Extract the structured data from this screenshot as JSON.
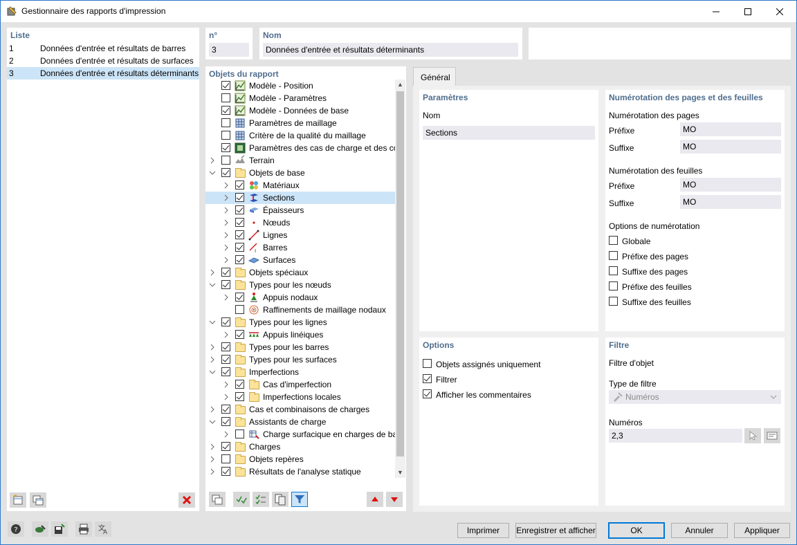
{
  "window": {
    "title": "Gestionnaire des rapports d'impression"
  },
  "liste": {
    "title": "Liste",
    "items": [
      {
        "num": "1",
        "label": "Données d'entrée et résultats de barres"
      },
      {
        "num": "2",
        "label": "Données d'entrée et résultats de surfaces"
      },
      {
        "num": "3",
        "label": "Données d'entrée et résultats déterminants"
      }
    ]
  },
  "header": {
    "num_label": "n°",
    "num_value": "3",
    "nom_label": "Nom",
    "nom_value": "Données d'entrée et résultats déterminants"
  },
  "objets": {
    "title": "Objets du rapport",
    "items": [
      {
        "label": "Modèle - Position",
        "checked": true,
        "level": 0,
        "chev": "none",
        "icon": "model-icon"
      },
      {
        "label": "Modèle - Paramètres",
        "checked": false,
        "level": 0,
        "chev": "none",
        "icon": "model-icon"
      },
      {
        "label": "Modèle - Données de base",
        "checked": true,
        "level": 0,
        "chev": "none",
        "icon": "model-icon"
      },
      {
        "label": "Paramètres de maillage",
        "checked": false,
        "level": 0,
        "chev": "none",
        "icon": "mesh-icon"
      },
      {
        "label": "Critère de la qualité du maillage",
        "checked": false,
        "level": 0,
        "chev": "none",
        "icon": "mesh-icon"
      },
      {
        "label": "Paramètres des cas de charge et des coml",
        "checked": true,
        "level": 0,
        "chev": "none",
        "icon": "loadcase-icon"
      },
      {
        "label": "Terrain",
        "checked": false,
        "level": 0,
        "chev": "right",
        "icon": "terrain-icon"
      },
      {
        "label": "Objets de base",
        "checked": true,
        "level": 0,
        "chev": "down",
        "icon": "folder"
      },
      {
        "label": "Matériaux",
        "checked": true,
        "level": 1,
        "chev": "right",
        "icon": "materials-icon"
      },
      {
        "label": "Sections",
        "checked": true,
        "level": 1,
        "chev": "right",
        "icon": "section-icon",
        "selected": true
      },
      {
        "label": "Épaisseurs",
        "checked": true,
        "level": 1,
        "chev": "right",
        "icon": "thickness-icon"
      },
      {
        "label": "Nœuds",
        "checked": true,
        "level": 1,
        "chev": "right",
        "icon": "node-icon"
      },
      {
        "label": "Lignes",
        "checked": true,
        "level": 1,
        "chev": "right",
        "icon": "line-icon"
      },
      {
        "label": "Barres",
        "checked": true,
        "level": 1,
        "chev": "right",
        "icon": "member-icon"
      },
      {
        "label": "Surfaces",
        "checked": true,
        "level": 1,
        "chev": "right",
        "icon": "surface-icon"
      },
      {
        "label": "Objets spéciaux",
        "checked": true,
        "level": 0,
        "chev": "right",
        "icon": "folder"
      },
      {
        "label": "Types pour les nœuds",
        "checked": true,
        "level": 0,
        "chev": "down",
        "icon": "folder"
      },
      {
        "label": "Appuis nodaux",
        "checked": true,
        "level": 1,
        "chev": "right",
        "icon": "nodal-support-icon"
      },
      {
        "label": "Raffinements de maillage nodaux",
        "checked": false,
        "level": 1,
        "chev": "none",
        "icon": "refinement-icon"
      },
      {
        "label": "Types pour les lignes",
        "checked": true,
        "level": 0,
        "chev": "down",
        "icon": "folder"
      },
      {
        "label": "Appuis linéiques",
        "checked": true,
        "level": 1,
        "chev": "right",
        "icon": "line-support-icon"
      },
      {
        "label": "Types pour les barres",
        "checked": true,
        "level": 0,
        "chev": "right",
        "icon": "folder"
      },
      {
        "label": "Types pour les surfaces",
        "checked": true,
        "level": 0,
        "chev": "right",
        "icon": "folder"
      },
      {
        "label": "Imperfections",
        "checked": true,
        "level": 0,
        "chev": "down",
        "icon": "folder"
      },
      {
        "label": "Cas d'imperfection",
        "checked": true,
        "level": 1,
        "chev": "right",
        "icon": "folder"
      },
      {
        "label": "Imperfections locales",
        "checked": true,
        "level": 1,
        "chev": "right",
        "icon": "folder"
      },
      {
        "label": "Cas et combinaisons de charges",
        "checked": true,
        "level": 0,
        "chev": "right",
        "icon": "folder"
      },
      {
        "label": "Assistants de charge",
        "checked": true,
        "level": 0,
        "chev": "down",
        "icon": "folder"
      },
      {
        "label": "Charge surfacique en charges de bar",
        "checked": false,
        "level": 1,
        "chev": "right",
        "icon": "load-wizard-icon"
      },
      {
        "label": "Charges",
        "checked": true,
        "level": 0,
        "chev": "right",
        "icon": "folder"
      },
      {
        "label": "Objets repères",
        "checked": false,
        "level": 0,
        "chev": "right",
        "icon": "folder"
      },
      {
        "label": "Résultats de l'analyse statique",
        "checked": true,
        "level": 0,
        "chev": "right",
        "icon": "folder"
      }
    ]
  },
  "tab": {
    "label": "Général"
  },
  "parametres": {
    "title": "Paramètres",
    "nom_label": "Nom",
    "nom_value": "Sections"
  },
  "numerotation": {
    "title": "Numérotation des pages et des feuilles",
    "pages_title": "Numérotation des pages",
    "prefixe_label": "Préfixe",
    "pages_prefixe": "MO",
    "suffixe_label": "Suffixe",
    "pages_suffixe": "MO",
    "feuilles_title": "Numérotation des feuilles",
    "feuilles_prefixe": "MO",
    "feuilles_suffixe": "MO",
    "options_title": "Options de numérotation",
    "options": [
      {
        "label": "Globale",
        "checked": false
      },
      {
        "label": "Préfixe des pages",
        "checked": false
      },
      {
        "label": "Suffixe des pages",
        "checked": false
      },
      {
        "label": "Préfixe des feuilles",
        "checked": false
      },
      {
        "label": "Suffixe des feuilles",
        "checked": false
      }
    ]
  },
  "options": {
    "title": "Options",
    "items": [
      {
        "label": "Objets assignés uniquement",
        "checked": false
      },
      {
        "label": "Filtrer",
        "checked": true
      },
      {
        "label": "Afficher les commentaires",
        "checked": true
      }
    ]
  },
  "filtre": {
    "title": "Filtre",
    "filtre_objet": "Filtre d'objet",
    "type_label": "Type de filtre",
    "type_value": "Numéros",
    "numeros_label": "Numéros",
    "numeros_value": "2,3"
  },
  "buttons": {
    "imprimer": "Imprimer",
    "enregistrer": "Enregistrer et afficher",
    "ok": "OK",
    "annuler": "Annuler",
    "appliquer": "Appliquer"
  },
  "colors": {
    "accent": "#0078d7",
    "section_title": "#506e8e",
    "selected_row": "#cce4f7",
    "delete_red": "#e01010"
  }
}
